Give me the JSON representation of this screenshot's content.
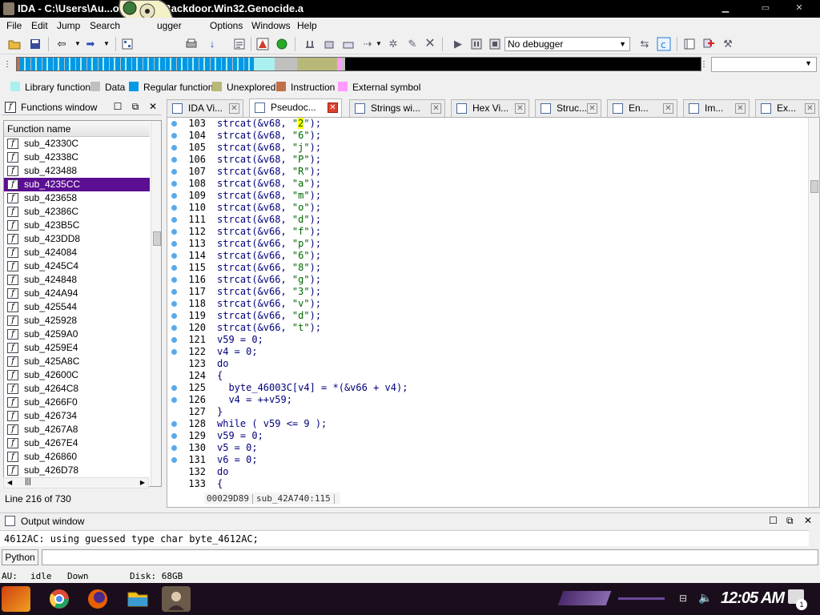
{
  "window": {
    "title": "IDA - C:\\Users\\Au...ownloads\\Backdoor.Win32.Genocide.a",
    "buttons": [
      "minimize",
      "maximize",
      "close"
    ]
  },
  "menu": [
    "File",
    "Edit",
    "Jump",
    "Search",
    "Debugger",
    "Options",
    "Windows",
    "Help"
  ],
  "toolbar": {
    "debugger_select": "No debugger"
  },
  "legend": [
    {
      "label": "Library function",
      "color": "#aaf0f0"
    },
    {
      "label": "Data",
      "color": "#c0c0c0"
    },
    {
      "label": "Regular function",
      "color": "#0099e6"
    },
    {
      "label": "Unexplored",
      "color": "#b8b878"
    },
    {
      "label": "Instruction",
      "color": "#c0704a"
    },
    {
      "label": "External symbol",
      "color": "#ff9bff"
    }
  ],
  "functions_window": {
    "title": "Functions window",
    "column_header": "Function name",
    "items": [
      "sub_42330C",
      "sub_42338C",
      "sub_423488",
      "sub_4235CC",
      "sub_423658",
      "sub_42386C",
      "sub_423B5C",
      "sub_423DD8",
      "sub_424084",
      "sub_4245C4",
      "sub_424848",
      "sub_424A94",
      "sub_425544",
      "sub_425928",
      "sub_4259A0",
      "sub_4259E4",
      "sub_425A8C",
      "sub_42600C",
      "sub_4264C8",
      "sub_4266F0",
      "sub_426734",
      "sub_4267A8",
      "sub_4267E4",
      "sub_426860",
      "sub_426D78"
    ],
    "selected_index": 3,
    "line_info": "Line 216 of 730"
  },
  "tabs": [
    {
      "label": "IDA Vi...",
      "icon": "ida-view-icon",
      "active": false
    },
    {
      "label": "Pseudoc...",
      "icon": "pseudocode-icon",
      "active": true
    },
    {
      "label": "Strings wi...",
      "icon": "strings-icon",
      "active": false
    },
    {
      "label": "Hex Vi...",
      "icon": "hex-view-icon",
      "active": false
    },
    {
      "label": "Struc...",
      "icon": "structures-icon",
      "active": false
    },
    {
      "label": "En...",
      "icon": "enums-icon",
      "active": false
    },
    {
      "label": "Im...",
      "icon": "imports-icon",
      "active": false
    },
    {
      "label": "Ex...",
      "icon": "exports-icon",
      "active": false
    }
  ],
  "code_lines": [
    {
      "n": "103",
      "dot": true,
      "code": "strcat(&v68, \"2\");"
    },
    {
      "n": "104",
      "dot": true,
      "code": "strcat(&v68, \"6\");"
    },
    {
      "n": "105",
      "dot": true,
      "code": "strcat(&v68, \"j\");"
    },
    {
      "n": "106",
      "dot": true,
      "code": "strcat(&v68, \"P\");"
    },
    {
      "n": "107",
      "dot": true,
      "code": "strcat(&v68, \"R\");"
    },
    {
      "n": "108",
      "dot": true,
      "code": "strcat(&v68, \"a\");"
    },
    {
      "n": "109",
      "dot": true,
      "code": "strcat(&v68, \"m\");"
    },
    {
      "n": "110",
      "dot": true,
      "code": "strcat(&v68, \"o\");"
    },
    {
      "n": "111",
      "dot": true,
      "code": "strcat(&v68, \"d\");"
    },
    {
      "n": "112",
      "dot": true,
      "code": "strcat(&v66, \"f\");"
    },
    {
      "n": "113",
      "dot": true,
      "code": "strcat(&v66, \"p\");"
    },
    {
      "n": "114",
      "dot": true,
      "code": "strcat(&v66, \"6\");"
    },
    {
      "n": "115",
      "dot": true,
      "code": "strcat(&v66, \"8\");"
    },
    {
      "n": "116",
      "dot": true,
      "code": "strcat(&v66, \"g\");"
    },
    {
      "n": "117",
      "dot": true,
      "code": "strcat(&v66, \"3\");"
    },
    {
      "n": "118",
      "dot": true,
      "code": "strcat(&v66, \"v\");"
    },
    {
      "n": "119",
      "dot": true,
      "code": "strcat(&v66, \"d\");"
    },
    {
      "n": "120",
      "dot": true,
      "code": "strcat(&v66, \"t\");"
    },
    {
      "n": "121",
      "dot": true,
      "code": "v59 = 0;"
    },
    {
      "n": "122",
      "dot": true,
      "code": "v4 = 0;"
    },
    {
      "n": "123",
      "dot": false,
      "code": "do"
    },
    {
      "n": "124",
      "dot": false,
      "code": "{"
    },
    {
      "n": "125",
      "dot": true,
      "code": "  byte_46003C[v4] = *(&v66 + v4);"
    },
    {
      "n": "126",
      "dot": true,
      "code": "  v4 = ++v59;"
    },
    {
      "n": "127",
      "dot": false,
      "code": "}"
    },
    {
      "n": "128",
      "dot": true,
      "code": "while ( v59 <= 9 );"
    },
    {
      "n": "129",
      "dot": true,
      "code": "v59 = 0;"
    },
    {
      "n": "130",
      "dot": true,
      "code": "v5 = 0;"
    },
    {
      "n": "131",
      "dot": true,
      "code": "v6 = 0;"
    },
    {
      "n": "132",
      "dot": false,
      "code": "do"
    },
    {
      "n": "133",
      "dot": false,
      "code": "{"
    }
  ],
  "code_status": {
    "address": "00029D89",
    "location": "sub_42A740:115"
  },
  "output_window": {
    "title": "Output window",
    "text": "4612AC: using guessed type char byte_4612AC;"
  },
  "python_button": "Python",
  "ida_status": {
    "au_label": "AU:",
    "au_state": "idle",
    "direction": "Down",
    "disk": "Disk: 68GB"
  },
  "taskbar": {
    "clock": "12:05 AM",
    "notification_count": "1"
  }
}
